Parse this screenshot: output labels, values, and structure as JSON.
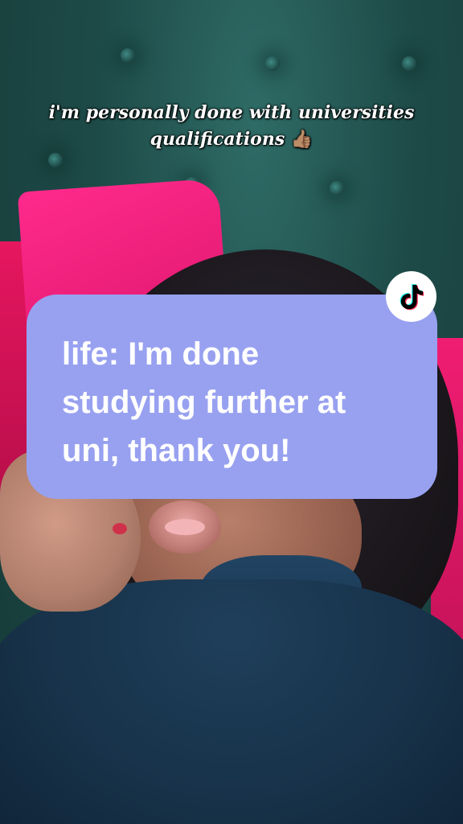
{
  "caption": {
    "line1": "i'm personally done with universities",
    "line2": "qualifications",
    "emoji": "👍🏽"
  },
  "bubble": {
    "lines": [
      "life: I'm done",
      "studying further at",
      "uni, thank you!"
    ],
    "background": "#98a1f0",
    "text_color": "#ffffff"
  },
  "badge": {
    "icon": "tiktok-logo-icon",
    "background": "#ffffff"
  }
}
